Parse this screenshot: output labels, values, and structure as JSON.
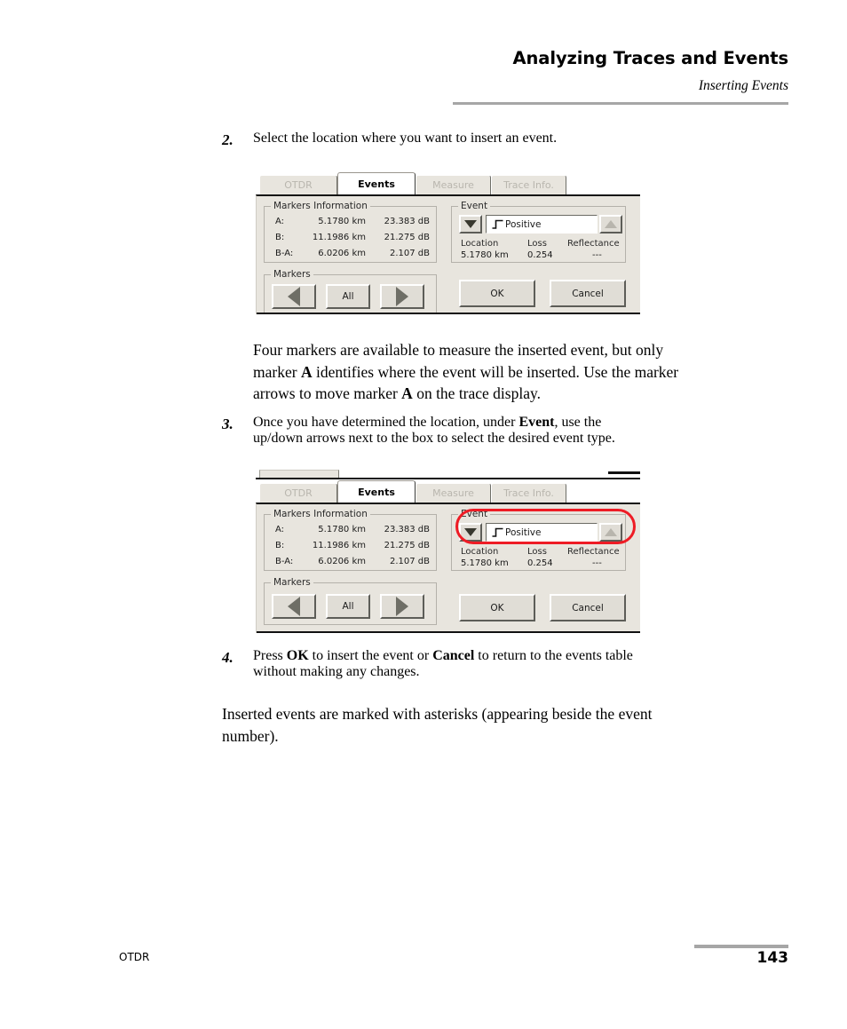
{
  "header": {
    "title": "Analyzing Traces and Events",
    "subtitle": "Inserting Events"
  },
  "steps": {
    "step2": {
      "number": "2.",
      "text": "Select the location where you want to insert an event."
    },
    "note1": {
      "line1_a": "Four markers are available to measure the inserted event, but only",
      "line2_a": "marker ",
      "line2_b": "A",
      "line2_c": " identifies where the event will be inserted. Use the marker",
      "line3_a": "arrows to move marker ",
      "line3_b": "A",
      "line3_c": " on the trace display."
    },
    "step3": {
      "number": "3.",
      "line1_a": "Once you have determined the location, under ",
      "line1_b": "Event",
      "line1_c": ", use the",
      "line2": "up/down arrows next to the box to select the desired event type."
    },
    "step4": {
      "number": "4.",
      "line1_a": "Press ",
      "line1_b": "OK",
      "line1_c": " to insert the event or ",
      "line1_d": "Cancel",
      "line1_e": " to return to the events table",
      "line2": "without making any changes."
    },
    "note2": {
      "line1": "Inserted events are marked with asterisks (appearing beside the event",
      "line2": "number)."
    }
  },
  "dialog": {
    "tabs": [
      {
        "label": "OTDR",
        "active": false
      },
      {
        "label": "Events",
        "active": true
      },
      {
        "label": "Measure",
        "active": false
      },
      {
        "label": "Trace Info.",
        "active": false
      }
    ],
    "markers_information": {
      "group_label": "Markers Information",
      "rows": [
        {
          "label": "A:",
          "distance": "5.1780 km",
          "level": "23.383 dB"
        },
        {
          "label": "B:",
          "distance": "11.1986 km",
          "level": "21.275 dB"
        },
        {
          "label": "B-A:",
          "distance": "6.0206 km",
          "level": "2.107 dB"
        }
      ]
    },
    "markers": {
      "group_label": "Markers",
      "prev_button": "prev-marker",
      "all_button": "All",
      "next_button": "next-marker"
    },
    "event": {
      "group_label": "Event",
      "type_value": "Positive",
      "down_arrow": "spin-down",
      "up_arrow": "spin-up",
      "columns": [
        {
          "header": "Location",
          "value": "5.1780 km"
        },
        {
          "header": "Loss",
          "value": "0.254"
        },
        {
          "header": "Reflectance",
          "value": "---"
        }
      ]
    },
    "actions": {
      "ok": "OK",
      "cancel": "Cancel"
    }
  },
  "annotation": {
    "highlight_color": "#ee1c25"
  },
  "footer": {
    "label": "OTDR",
    "page_number": "143"
  }
}
